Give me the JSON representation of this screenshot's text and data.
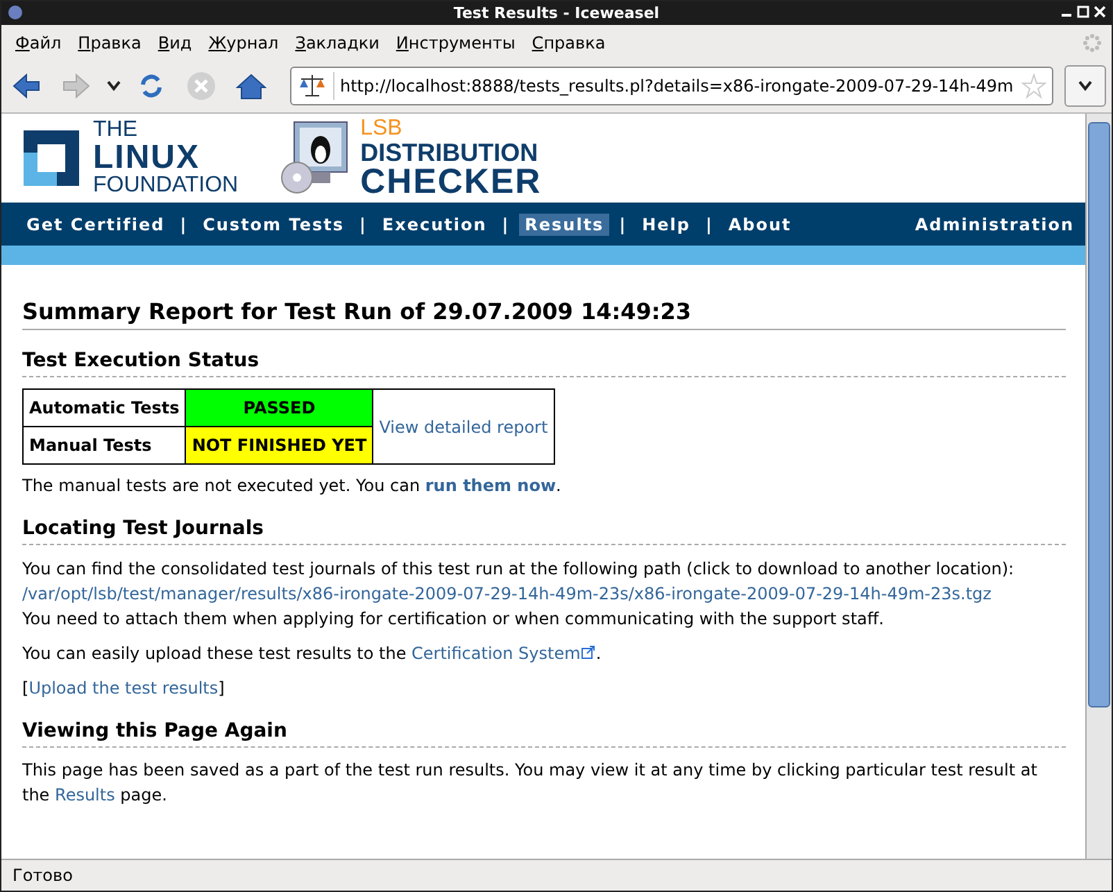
{
  "window": {
    "title": "Test Results - Iceweasel"
  },
  "menu": [
    "Файл",
    "Правка",
    "Вид",
    "Журнал",
    "Закладки",
    "Инструменты",
    "Справка"
  ],
  "address_bar": {
    "value": "http://localhost:8888/tests_results.pl?details=x86-irongate-2009-07-29-14h-49m"
  },
  "logos": {
    "foundation": {
      "line_1": "THE",
      "line_2": "LINUX",
      "line_3": "FOUNDATION"
    },
    "checker": {
      "line_1": "LSB",
      "line_2": "DISTRIBUTION",
      "line_3": "CHECKER"
    }
  },
  "nav": {
    "items": [
      {
        "label": "Get Certified",
        "selected": false
      },
      {
        "label": "Custom Tests",
        "selected": false
      },
      {
        "label": "Execution",
        "selected": false
      },
      {
        "label": "Results",
        "selected": true
      },
      {
        "label": "Help",
        "selected": false
      },
      {
        "label": "About",
        "selected": false
      }
    ],
    "separator": "|",
    "right": "Administration"
  },
  "title": "Summary Report for Test Run of 29.07.2009 14:49:23",
  "status_section": {
    "heading": "Test Execution Status",
    "rows": [
      {
        "label": "Automatic Tests",
        "status": "PASSED",
        "kind": "passed"
      },
      {
        "label": "Manual Tests",
        "status": "NOT FINISHED YET",
        "kind": "pending"
      }
    ],
    "report_link": "View detailed report",
    "note": {
      "before": "The manual tests are not executed yet. You can ",
      "link": "run them now",
      "after": "."
    }
  },
  "journals_section": {
    "heading": "Locating Test Journals",
    "intro": "You can find the consolidated test journals of this test run at the following path (click to download to another location):",
    "path_link": "/var/opt/lsb/test/manager/results/x86-irongate-2009-07-29-14h-49m-23s/x86-irongate-2009-07-29-14h-49m-23s.tgz",
    "attach_note": "You need to attach them when applying for certification or when communicating with the support staff.",
    "upload_note": {
      "before": "You can easily upload these test results to the ",
      "link": "Certification System",
      "after": "."
    },
    "upload_link": {
      "open": "[",
      "link": "Upload the test results",
      "close": "]"
    }
  },
  "viewing_section": {
    "heading": "Viewing this Page Again",
    "text": {
      "before": "This page has been saved as a part of the test run results. You may view it at any time by clicking particular test result at the ",
      "link": "Results",
      "after": " page."
    }
  },
  "status_bar": "Готово"
}
